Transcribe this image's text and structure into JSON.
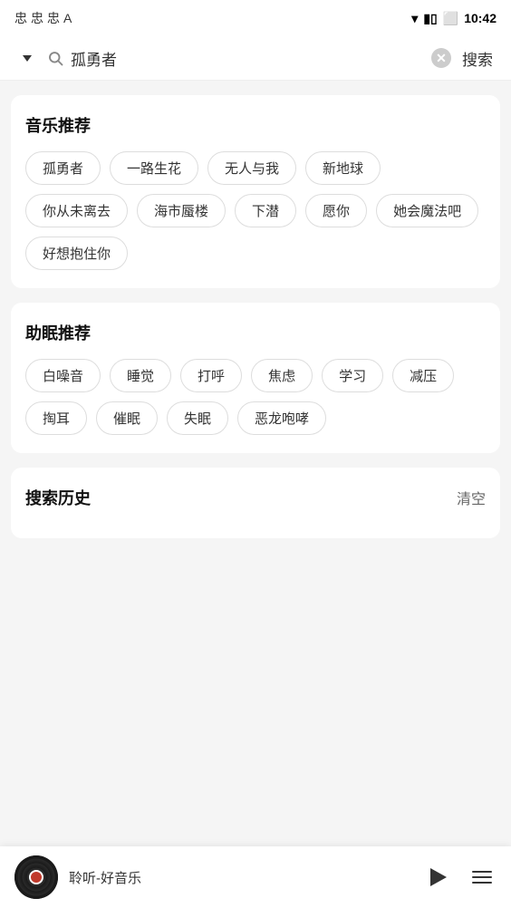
{
  "statusBar": {
    "icons": [
      "忠",
      "忠",
      "忠",
      "A"
    ],
    "time": "10:42"
  },
  "searchBar": {
    "inputValue": "孤勇者",
    "searchLabel": "搜索"
  },
  "musicSection": {
    "title": "音乐推荐",
    "tags": [
      "孤勇者",
      "一路生花",
      "无人与我",
      "新地球",
      "你从未离去",
      "海市蜃楼",
      "下潜",
      "愿你",
      "她会魔法吧",
      "好想抱住你"
    ]
  },
  "sleepSection": {
    "title": "助眠推荐",
    "tags": [
      "白噪音",
      "睡觉",
      "打呼",
      "焦虑",
      "学习",
      "减压",
      "掏耳",
      "催眠",
      "失眠",
      "恶龙咆哮"
    ]
  },
  "historySection": {
    "title": "搜索历史",
    "clearLabel": "清空"
  },
  "playerBar": {
    "title": "聆听-好音乐"
  }
}
